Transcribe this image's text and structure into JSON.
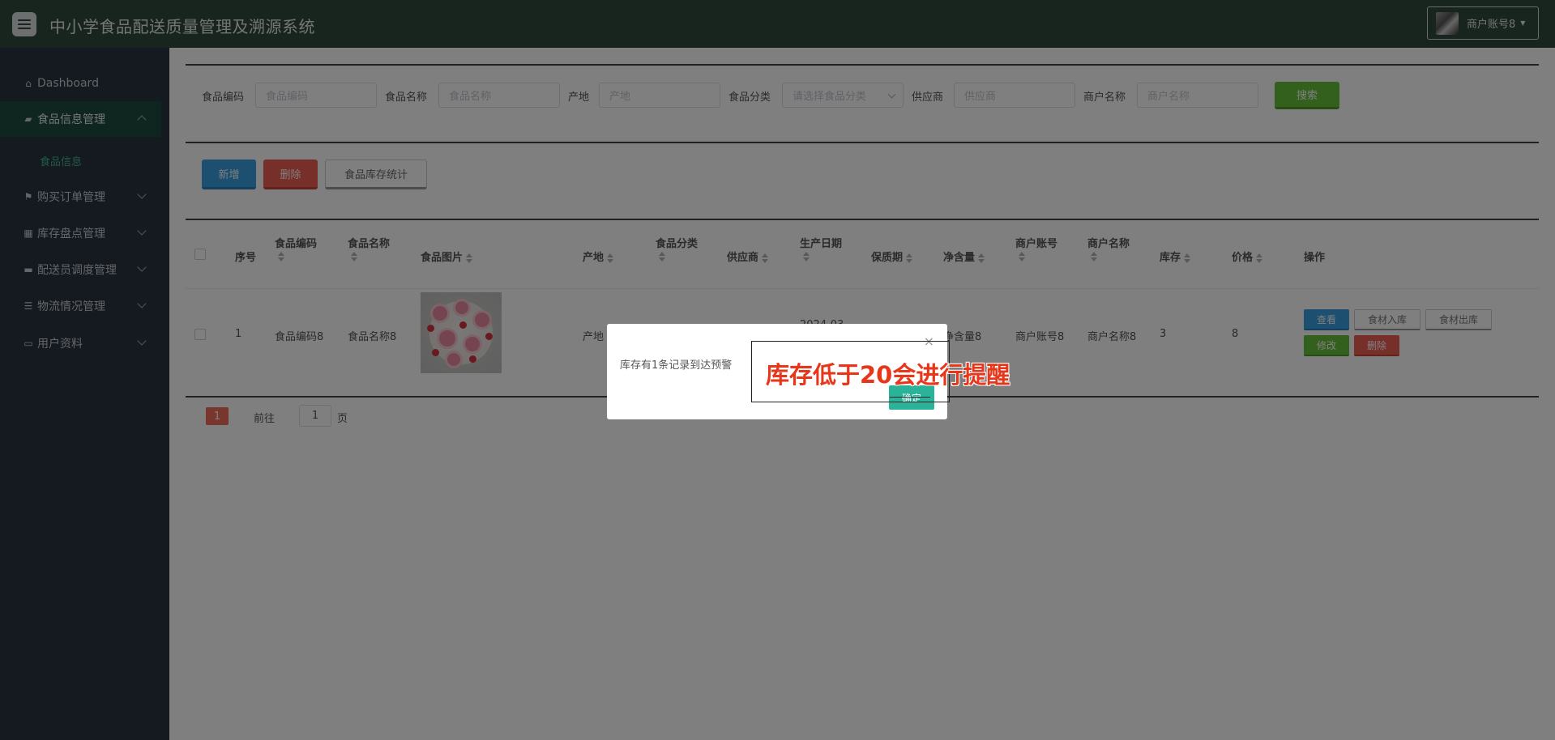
{
  "header": {
    "title": "中小学食品配送质量管理及溯源系统",
    "user_name": "商户账号8"
  },
  "sidebar": {
    "items": [
      {
        "label": "Dashboard"
      },
      {
        "label": "食品信息管理"
      },
      {
        "label": "购买订单管理"
      },
      {
        "label": "库存盘点管理"
      },
      {
        "label": "配送员调度管理"
      },
      {
        "label": "物流情况管理"
      },
      {
        "label": "用户资料"
      }
    ],
    "sub_item": "食品信息"
  },
  "search": {
    "fields": [
      {
        "label": "食品编码",
        "placeholder": "食品编码"
      },
      {
        "label": "食品名称",
        "placeholder": "食品名称"
      },
      {
        "label": "产地",
        "placeholder": "产地"
      },
      {
        "label": "食品分类",
        "placeholder": "请选择食品分类"
      },
      {
        "label": "供应商",
        "placeholder": "供应商"
      },
      {
        "label": "商户名称",
        "placeholder": "商户名称"
      }
    ],
    "button": "搜索"
  },
  "actions": {
    "add": "新增",
    "delete": "删除",
    "stats": "食品库存统计"
  },
  "table": {
    "headers": [
      "序号",
      "食品编码",
      "食品名称",
      "食品图片",
      "产地",
      "食品分类",
      "供应商",
      "生产日期",
      "保质期",
      "净含量",
      "商户账号",
      "商户名称",
      "库存",
      "价格",
      "操作"
    ],
    "row": {
      "index": "1",
      "code": "食品编码8",
      "name": "食品名称8",
      "origin": "产地",
      "date": "2024-03",
      "net": "净含量8",
      "account": "商户账号8",
      "merchant": "商户名称8",
      "stock": "3",
      "price": "8"
    },
    "ops": {
      "view": "查看",
      "in": "食材入库",
      "out": "食材出库",
      "edit": "修改",
      "del": "删除"
    }
  },
  "pagination": {
    "current": "1",
    "goto_prefix": "前往",
    "goto_value": "1",
    "goto_suffix": "页"
  },
  "dialog": {
    "message": "库存有1条记录到达预警",
    "ok": "确定",
    "close": "×"
  },
  "annotation": {
    "text": "库存低于20会进行提醒",
    "color": "#e8361b"
  }
}
